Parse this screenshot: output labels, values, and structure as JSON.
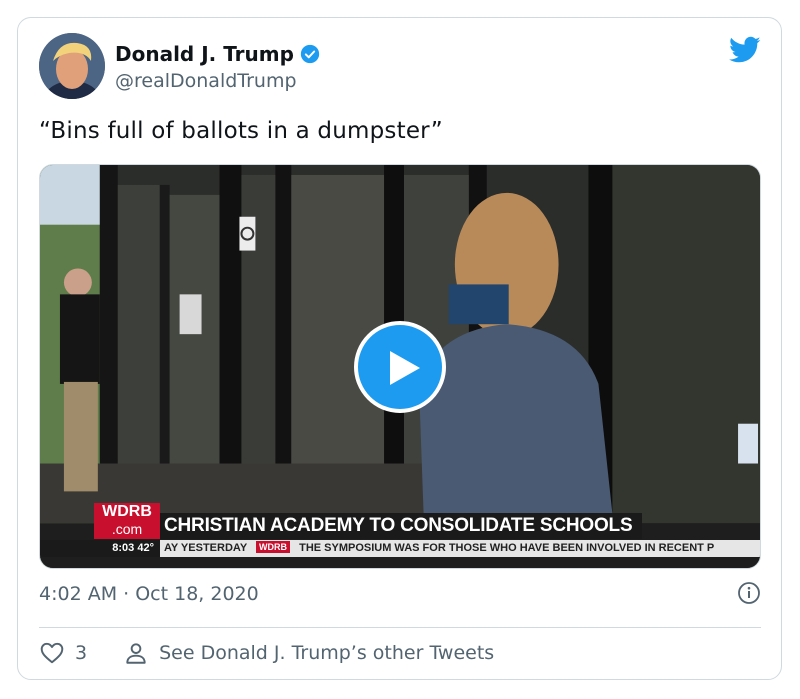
{
  "author": {
    "name": "Donald J. Trump",
    "handle": "@realDonaldTrump",
    "verified": true
  },
  "tweet": {
    "text": "“Bins full of ballots in a dumpster”",
    "timestamp": "4:02 AM · Oct 18, 2020"
  },
  "video_overlay": {
    "station_logo": "WDRB",
    "station_logo_sub": ".com",
    "headline": "CHRISTIAN ACADEMY TO CONSOLIDATE SCHOOLS",
    "ticker_time": "8:03",
    "ticker_temp": "42°",
    "ticker_left": "AY YESTERDAY",
    "ticker_logo": "WDRB",
    "ticker_right": "THE SYMPOSIUM WAS FOR THOSE WHO HAVE BEEN INVOLVED IN RECENT P"
  },
  "actions": {
    "like_count": "3",
    "other_tweets_label": "See Donald J. Trump’s other Tweets"
  },
  "colors": {
    "accent": "#1d9bf0",
    "text_primary": "#0f1419",
    "text_secondary": "#536471",
    "border": "#cfd9de",
    "news_red": "#c8102e"
  },
  "icons": [
    "twitter-bird-icon",
    "verified-badge-icon",
    "play-icon",
    "info-icon",
    "heart-icon",
    "person-icon"
  ]
}
